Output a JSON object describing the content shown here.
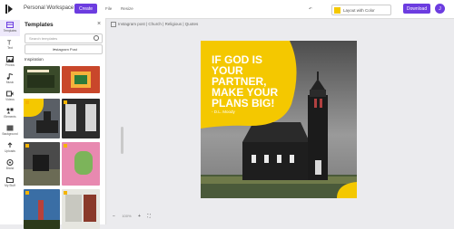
{
  "header": {
    "brand": "Personal Workspace",
    "create_label": "Create",
    "menu_file": "File",
    "menu_resize": "Resize",
    "layout_label": "Layout with Color",
    "download_label": "Download",
    "avatar_initial": "J",
    "accent": "#6c3ce0"
  },
  "toolbar": [
    {
      "label": "Templates",
      "icon": "templates-icon"
    },
    {
      "label": "Text",
      "icon": "text-icon"
    },
    {
      "label": "Photos",
      "icon": "photos-icon"
    },
    {
      "label": "Music",
      "icon": "music-icon"
    },
    {
      "label": "Videos",
      "icon": "videos-icon"
    },
    {
      "label": "Elements",
      "icon": "elements-icon"
    },
    {
      "label": "Background",
      "icon": "background-icon"
    },
    {
      "label": "Uploads",
      "icon": "uploads-icon"
    },
    {
      "label": "Brand",
      "icon": "brand-icon"
    },
    {
      "label": "My Stuff",
      "icon": "folder-icon"
    }
  ],
  "panel": {
    "title": "Templates",
    "search_placeholder": "Search templates",
    "select_value": "Instagram Post",
    "section_label": "Inspiration"
  },
  "breadcrumb": "Instagram post  |  Church  |  Religious  |  Quotes",
  "design": {
    "headline_lines": [
      "IF GOD IS",
      "YOUR",
      "PARTNER,",
      "MAKE YOUR",
      "PLANS BIG!"
    ],
    "author": "- D.L. Moody",
    "accent": "#f4c800"
  },
  "zoom_label": "100%"
}
